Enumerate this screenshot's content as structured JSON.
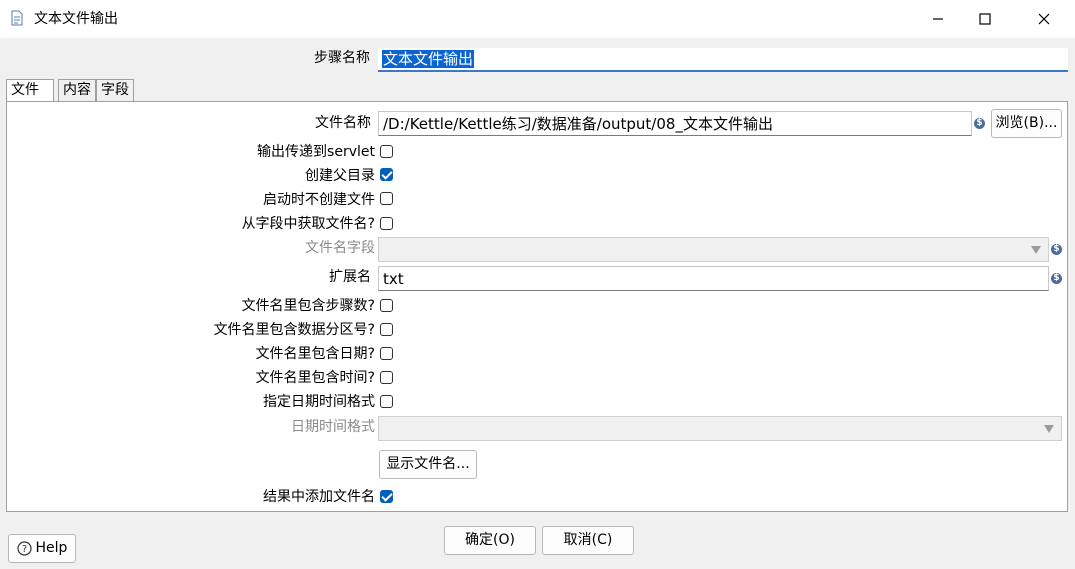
{
  "window": {
    "title": "文本文件输出",
    "app_icon": "document-icon",
    "controls": [
      "minimize-icon",
      "maximize-icon",
      "close-icon"
    ]
  },
  "step_name": {
    "label": "步骤名称",
    "value": "文本文件输出"
  },
  "tabs": [
    {
      "label": "文件",
      "active": true
    },
    {
      "label": "内容",
      "active": false
    },
    {
      "label": "字段",
      "active": false
    }
  ],
  "file": {
    "filename_label": "文件名称",
    "filename_value": "/D:/Kettle/Kettle练习/数据准备/output/08_文本文件输出",
    "browse_button": "浏览(B)...",
    "servlet_label": "输出传递到servlet",
    "servlet_checked": false,
    "create_parent_label": "创建父目录",
    "create_parent_checked": true,
    "no_create_at_start_label": "启动时不创建文件",
    "no_create_at_start_checked": false,
    "filename_from_field_label": "从字段中获取文件名?",
    "filename_from_field_checked": false,
    "filename_field_label": "文件名字段",
    "filename_field_value": "",
    "extension_label": "扩展名",
    "extension_value": "txt",
    "include_stepnr_label": "文件名里包含步骤数?",
    "include_stepnr_checked": false,
    "include_partnr_label": "文件名里包含数据分区号?",
    "include_partnr_checked": false,
    "include_date_label": "文件名里包含日期?",
    "include_date_checked": false,
    "include_time_label": "文件名里包含时间?",
    "include_time_checked": false,
    "specify_datetime_format_label": "指定日期时间格式",
    "specify_datetime_format_checked": false,
    "datetime_format_label": "日期时间格式",
    "datetime_format_value": "",
    "show_filenames_button": "显示文件名...",
    "add_to_result_label": "结果中添加文件名",
    "add_to_result_checked": true
  },
  "footer": {
    "help_button": "Help",
    "ok_button": "确定(O)",
    "cancel_button": "取消(C)"
  },
  "colors": {
    "accent": "#005fb8",
    "selection": "#0a64d2"
  }
}
